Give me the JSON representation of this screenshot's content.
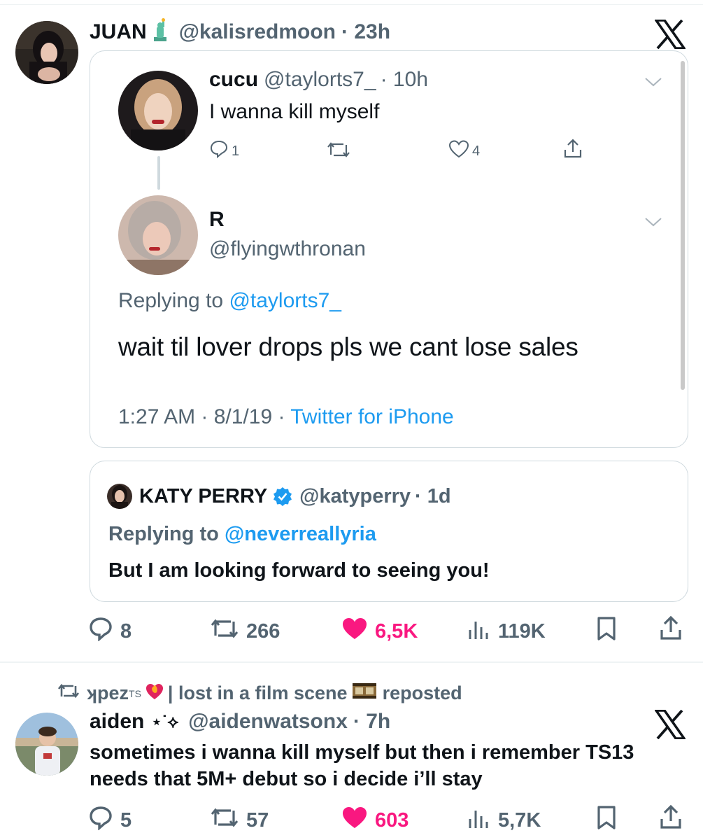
{
  "tweet1": {
    "author_name": "JUAN",
    "author_emoji": "statue-of-liberty",
    "author_handle": "@kalisredmoon",
    "time": "· 23h",
    "source_icon": "x-logo-icon",
    "screenshot": {
      "tweet_a": {
        "name": "cucu",
        "handle": "@taylorts7_",
        "time": "· 10h",
        "text": "I wanna kill myself",
        "replies": "1",
        "likes": "4"
      },
      "tweet_b": {
        "name": "R",
        "handle": "@flyingwthronan",
        "replying_prefix": "Replying to ",
        "replying_handle": "@taylorts7_",
        "text": "wait til lover drops pls we cant lose sales",
        "time": "1:27 AM · 8/1/19 · ",
        "source": "Twitter for iPhone"
      }
    },
    "quote": {
      "name": "KATY PERRY",
      "handle": "@katyperry",
      "time": "· 1d",
      "replying_prefix": "Replying to ",
      "replying_handle": "@neverreallyria",
      "text": "But I am looking forward to seeing you!"
    },
    "actions": {
      "replies": "8",
      "reposts": "266",
      "likes": "6,5K",
      "views": "119K"
    }
  },
  "tweet2": {
    "reposter_name": "ʞpez",
    "reposter_sup": "TS",
    "reposter_tail": "| lost in a film scene",
    "reposted_label": "reposted",
    "author_name": "aiden",
    "author_deco": "⋆˙⟡",
    "author_handle": "@aidenwatsonx",
    "time": "· 7h",
    "text": "sometimes i wanna kill myself but then i remember TS13 needs that 5M+ debut so i decide i’ll stay",
    "actions": {
      "replies": "5",
      "reposts": "57",
      "likes": "603",
      "views": "5,7K"
    }
  },
  "colors": {
    "text": "#0f1419",
    "secondary": "#536471",
    "link": "#1d9bf0",
    "like": "#f91880",
    "border": "#cfd9de"
  }
}
